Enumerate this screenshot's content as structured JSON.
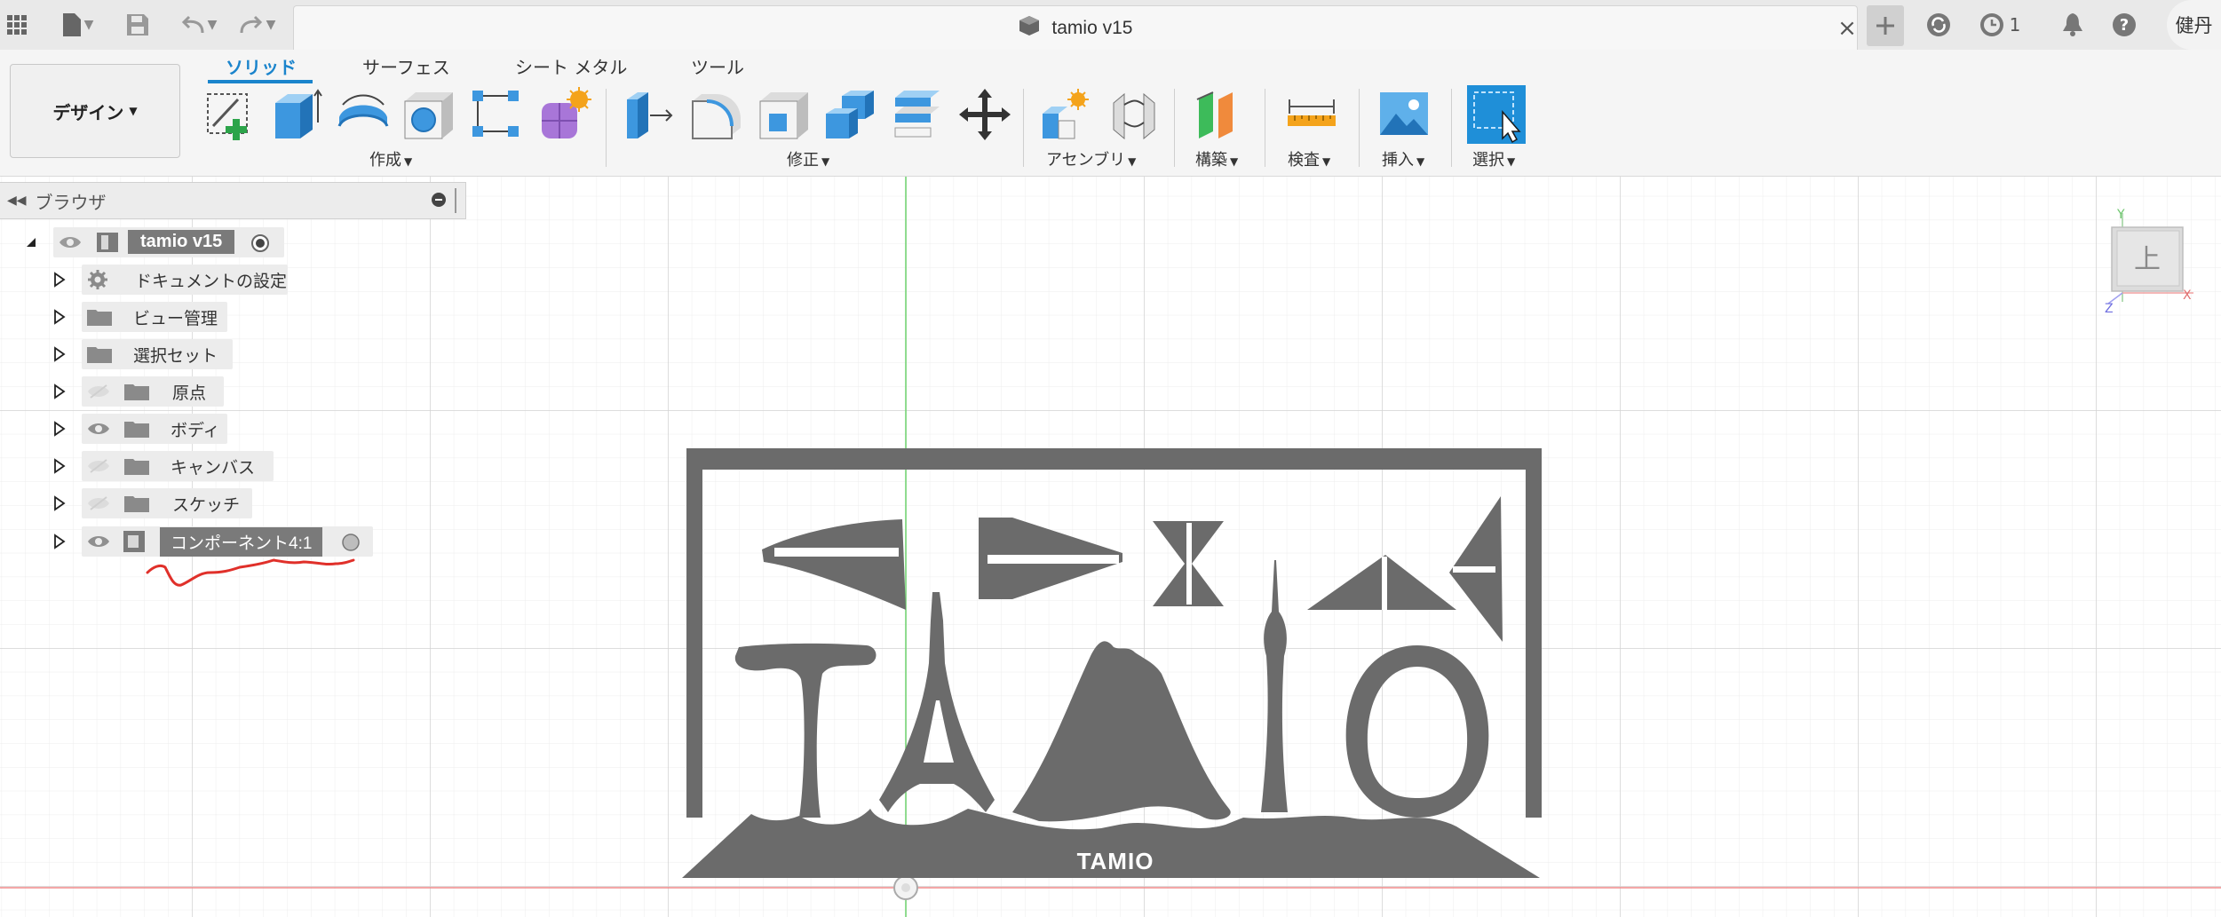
{
  "window": {
    "title": "tamio v15",
    "user": "健丹",
    "job_count": "1"
  },
  "ribbon": {
    "workspace": "デザイン",
    "tabs": [
      "ソリッド",
      "サーフェス",
      "シート メタル",
      "ツール"
    ],
    "groups": [
      "作成",
      "修正",
      "アセンブリ",
      "構築",
      "検査",
      "挿入",
      "選択"
    ]
  },
  "browser": {
    "title": "ブラウザ",
    "root": "tamio v15",
    "items": [
      "ドキュメントの設定",
      "ビュー管理",
      "選択セット",
      "原点",
      "ボディ",
      "キャンバス",
      "スケッチ",
      "コンポーネント4:1"
    ]
  },
  "viewcube": {
    "face": "上",
    "axis_x": "X",
    "axis_y": "Y",
    "axis_z": "Z"
  },
  "model": {
    "engraving": "TAMIO"
  },
  "colors": {
    "accent": "#1a84cc",
    "model": "#6b6b6b",
    "annotation": "#e0302a",
    "select_tool": "#1f8fd8"
  },
  "icons": [
    "app-grid-icon",
    "file-icon",
    "save-icon",
    "undo-icon",
    "redo-icon",
    "close-icon",
    "plus-icon",
    "sync-icon",
    "clock-icon",
    "bell-icon",
    "help-icon"
  ]
}
